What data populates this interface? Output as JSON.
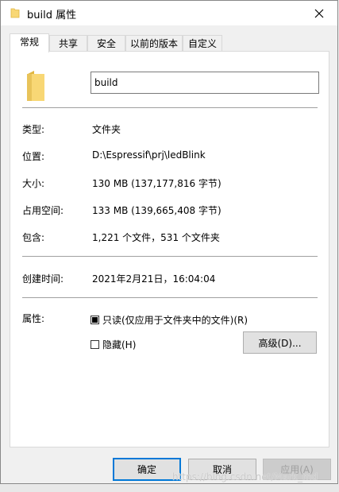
{
  "window": {
    "title": "build 属性",
    "close_label": "×"
  },
  "tabs": [
    {
      "label": "常规",
      "active": true
    },
    {
      "label": "共享",
      "active": false
    },
    {
      "label": "安全",
      "active": false
    },
    {
      "label": "以前的版本",
      "active": false
    },
    {
      "label": "自定义",
      "active": false
    }
  ],
  "general": {
    "name_value": "build",
    "type_label": "类型:",
    "type_value": "文件夹",
    "location_label": "位置:",
    "location_value": "D:\\Espressif\\prj\\ledBlink",
    "size_label": "大小:",
    "size_value": "130 MB (137,177,816 字节)",
    "size_on_disk_label": "占用空间:",
    "size_on_disk_value": "133 MB (139,665,408 字节)",
    "contains_label": "包含:",
    "contains_value": "1,221 个文件，531 个文件夹",
    "created_label": "创建时间:",
    "created_value": "2021年2月21日，16:04:04",
    "attributes_label": "属性:",
    "readonly_label": "只读(仅应用于文件夹中的文件)(R)",
    "readonly_state": "indeterminate",
    "hidden_label": "隐藏(H)",
    "hidden_state": "unchecked",
    "advanced_button": "高级(D)..."
  },
  "footer": {
    "ok": "确定",
    "cancel": "取消",
    "apply": "应用(A)"
  },
  "watermark": "https://blog.csdn.net/Mark_md",
  "colors": {
    "folder_yellow": "#f8d775",
    "folder_dark": "#e0b540",
    "primary_border": "#0078d7"
  }
}
